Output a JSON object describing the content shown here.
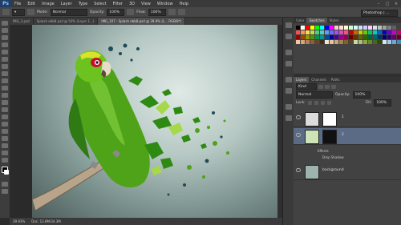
{
  "menubar": {
    "logo": "Ps",
    "items": [
      "File",
      "Edit",
      "Image",
      "Layer",
      "Type",
      "Select",
      "Filter",
      "3D",
      "View",
      "Window",
      "Help"
    ],
    "window_controls": [
      "–",
      "□",
      "×"
    ]
  },
  "options": {
    "mode_label": "Mode:",
    "mode_value": "Normal",
    "opacity_label": "Opacity:",
    "opacity_value": "100%",
    "flow_label": "Flow:",
    "flow_value": "100%",
    "workspace": "Photoshop | ..."
  },
  "tabs": [
    {
      "label": "IMG_1.psd",
      "active": false
    },
    {
      "label": "Splash ebb8.psd @ 50% (Layer 1...)",
      "active": false
    },
    {
      "label": "IMG_107 - Splash ebb8.psd @ 39.9% (L... RGB/8*)",
      "active": true
    }
  ],
  "status": {
    "zoom": "39.93%",
    "doc": "Doc: 13.8M/34.3M"
  },
  "swatches": {
    "tabs": [
      {
        "label": "Color",
        "active": false
      },
      {
        "label": "Swatches",
        "active": true
      },
      {
        "label": "Styles",
        "active": false
      }
    ],
    "colors": [
      "#000000",
      "#ffffff",
      "#ff0000",
      "#ffff00",
      "#00ff00",
      "#00ffff",
      "#0000ff",
      "#ff00ff",
      "#ffcccc",
      "#ffe0cc",
      "#ffffcc",
      "#ccffcc",
      "#ccffff",
      "#cce0ff",
      "#ccccff",
      "#ffccff",
      "#e0e0e0",
      "#c0c0c0",
      "#a0a0a0",
      "#808080",
      "#606060",
      "#404040",
      "#ff4d4d",
      "#ff944d",
      "#ffdb4d",
      "#b8e04d",
      "#4dd27a",
      "#4dd2c6",
      "#4da6ff",
      "#6b6bff",
      "#a64dff",
      "#e04dbd",
      "#ff4d8c",
      "#cc0000",
      "#cc6600",
      "#cccc00",
      "#66cc00",
      "#00cc66",
      "#00cccc",
      "#0066cc",
      "#0000cc",
      "#6600cc",
      "#cc00cc",
      "#cc0066",
      "#990000",
      "#994c00",
      "#999900",
      "#4c9900",
      "#00994c",
      "#009999",
      "#004c99",
      "#000099",
      "#4c0099",
      "#990099",
      "#99004c",
      "#660000",
      "#663300",
      "#666600",
      "#336600",
      "#006633",
      "#006666",
      "#003366",
      "#000066",
      "#330066",
      "#660066",
      "#660033",
      "#f2c7a0",
      "#d8a37a",
      "#b47e57",
      "#8e5e3c",
      "#6b4327",
      "#4a2c16",
      "#f5e6c8",
      "#e0c89c",
      "#c8a870",
      "#a88548",
      "#806230",
      "#5c4420",
      "#c8d8a8",
      "#a8c078",
      "#88a848",
      "#688828",
      "#486818",
      "#304808",
      "#d0e8f0",
      "#a0c8e0",
      "#70a8d0",
      "#4088c0"
    ]
  },
  "layers": {
    "tabs": [
      {
        "label": "Layers",
        "active": true
      },
      {
        "label": "Channels",
        "active": false
      },
      {
        "label": "Paths",
        "active": false
      }
    ],
    "kind_label": "Kind",
    "blend_value": "Normal",
    "opacity_label": "Opacity:",
    "opacity_value": "100%",
    "lock_label": "Lock:",
    "fill_label": "Fill:",
    "fill_value": "100%",
    "rows": [
      {
        "name": "1"
      },
      {
        "name": "2"
      },
      {
        "name": "background"
      }
    ],
    "effects_label": "Effects",
    "drop_shadow_label": "Drop Shadow"
  }
}
